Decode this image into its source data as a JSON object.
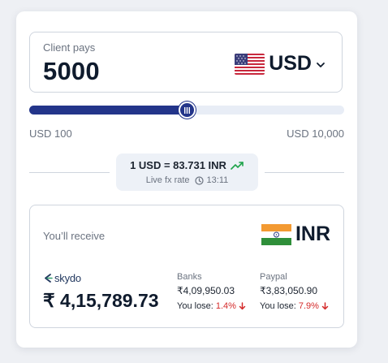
{
  "payer": {
    "label": "Client pays",
    "amount": "5000",
    "currency": "USD",
    "currency_icon": "us-flag-icon",
    "dropdown_icon": "chevron-down-icon"
  },
  "slider": {
    "min_label": "USD 100",
    "max_label": "USD 10,000",
    "value_fraction": 0.5
  },
  "rate": {
    "text": "1 USD = 83.731 INR",
    "trend_icon": "trending-up-icon",
    "label": "Live fx rate",
    "time": "13:11",
    "trend_color": "#1ea34a"
  },
  "receiver": {
    "label": "You’ll receive",
    "currency": "INR",
    "currency_icon": "india-flag-icon",
    "brand": "skydo",
    "amount": "₹ 4,15,789.73"
  },
  "comparisons": [
    {
      "title": "Banks",
      "amount": "₹4,09,950.03",
      "lose_label": "You lose:",
      "lose_pct": "1.4%"
    },
    {
      "title": "Paypal",
      "amount": "₹3,83,050.90",
      "lose_label": "You lose:",
      "lose_pct": "7.9%"
    }
  ],
  "colors": {
    "accent": "#23358a",
    "loss": "#d42a2a",
    "muted": "#6b7380"
  }
}
